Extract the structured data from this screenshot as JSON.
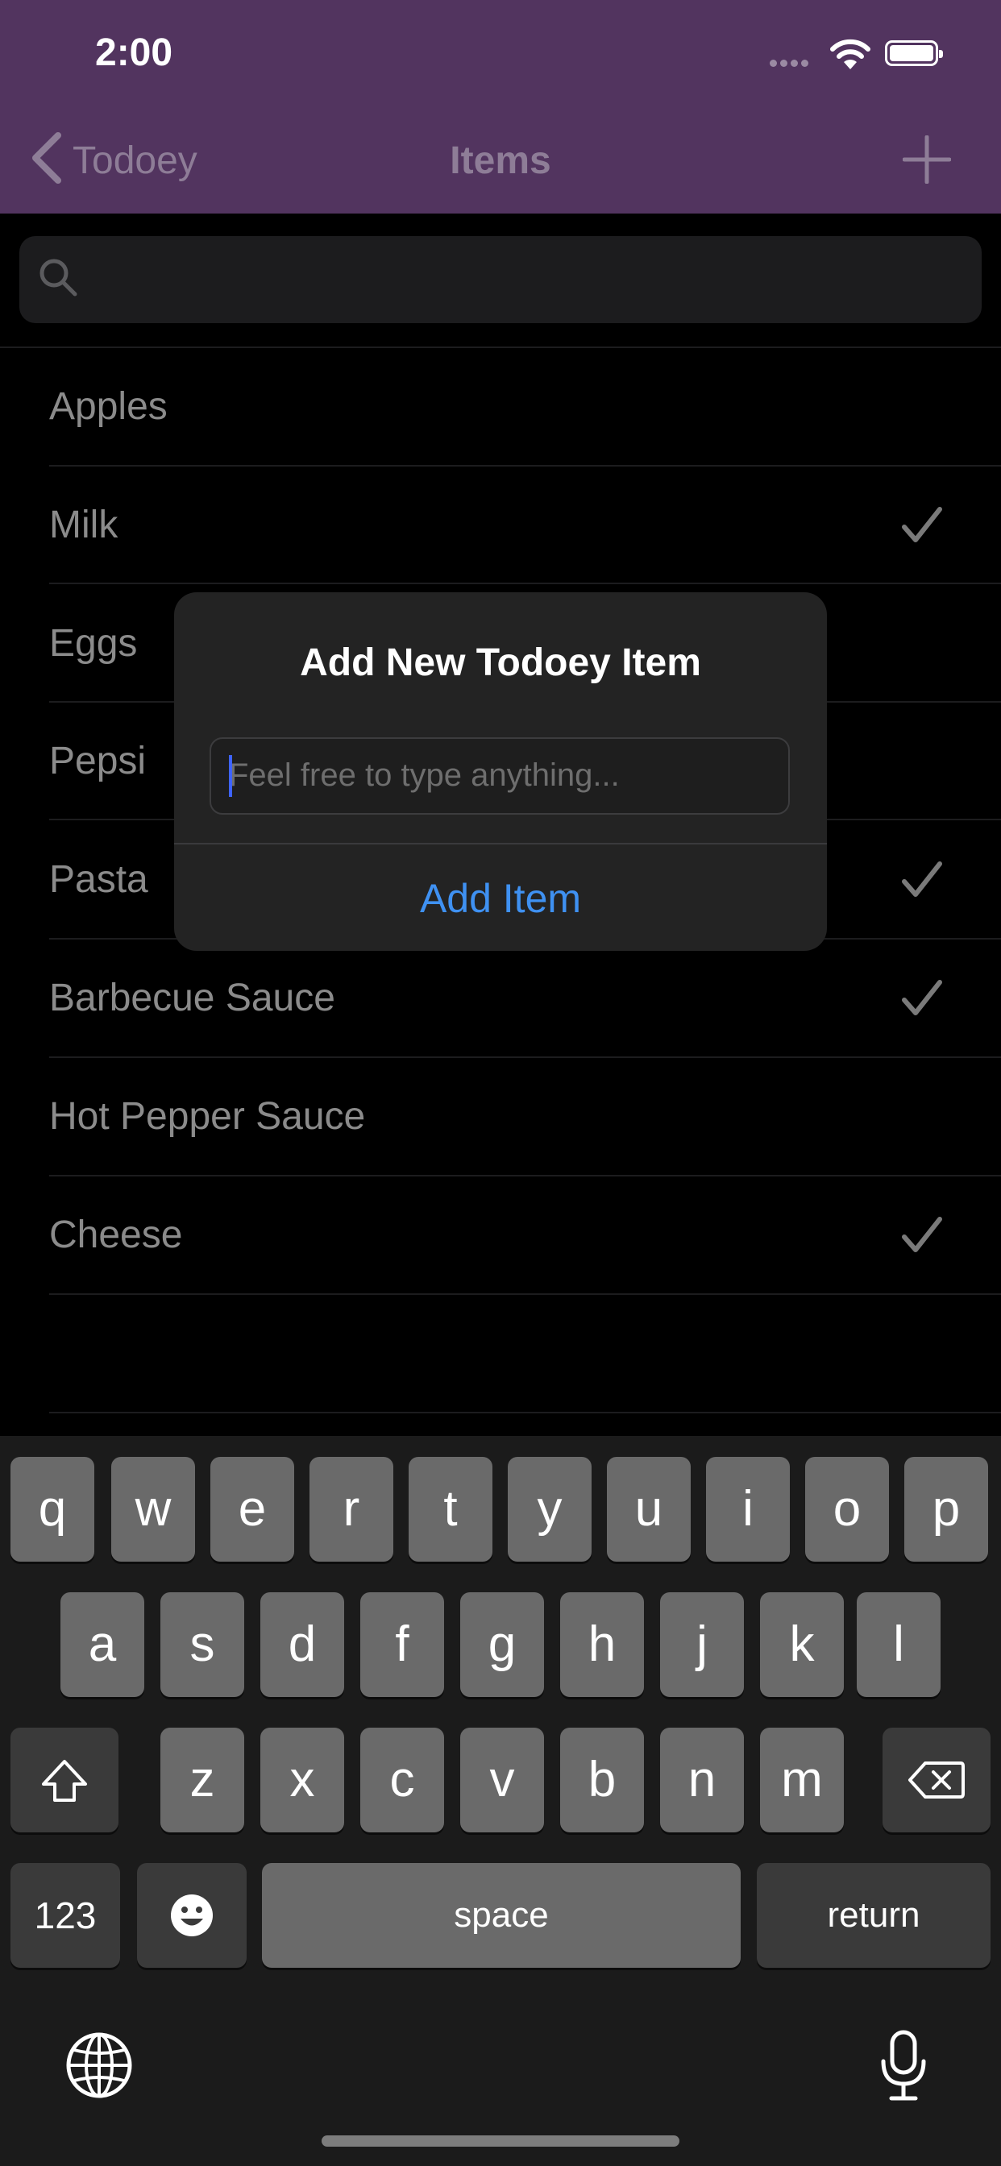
{
  "status_bar": {
    "time": "2:00"
  },
  "nav": {
    "back_label": "Todoey",
    "title": "Items"
  },
  "items": [
    {
      "label": "Apples",
      "checked": false
    },
    {
      "label": "Milk",
      "checked": true
    },
    {
      "label": "Eggs",
      "checked": false
    },
    {
      "label": "Pepsi",
      "checked": false
    },
    {
      "label": "Pasta",
      "checked": true
    },
    {
      "label": "Barbecue Sauce",
      "checked": true
    },
    {
      "label": "Hot Pepper Sauce",
      "checked": false
    },
    {
      "label": "Cheese",
      "checked": true
    }
  ],
  "dialog": {
    "title": "Add New Todoey Item",
    "placeholder": "Feel free to type anything...",
    "action_label": "Add Item"
  },
  "keyboard": {
    "row1": [
      "q",
      "w",
      "e",
      "r",
      "t",
      "y",
      "u",
      "i",
      "o",
      "p"
    ],
    "row2": [
      "a",
      "s",
      "d",
      "f",
      "g",
      "h",
      "j",
      "k",
      "l"
    ],
    "row3": [
      "z",
      "x",
      "c",
      "v",
      "b",
      "n",
      "m"
    ],
    "numbers_label": "123",
    "space_label": "space",
    "return_label": "return"
  },
  "colors": {
    "nav_background": "#52345f",
    "accent_blue": "#3f91f2"
  }
}
